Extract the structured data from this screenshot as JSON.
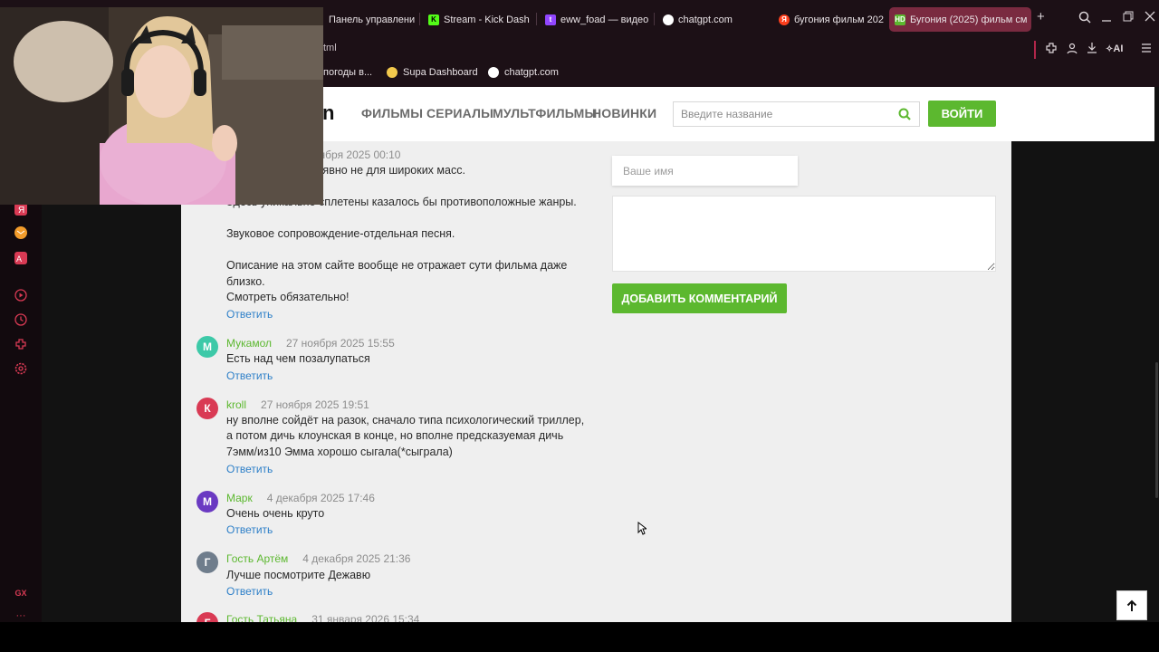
{
  "browser": {
    "tabs": [
      {
        "label": "Панель управлени",
        "color": "#7a6a70"
      },
      {
        "label": "Stream - Kick Dash",
        "color": "#53fc18"
      },
      {
        "label": "eww_foad — видео",
        "color": "#9146ff"
      },
      {
        "label": "chatgpt.com",
        "color": "#ffffff"
      },
      {
        "label": "бугония фильм 202",
        "color": "#fc3f1d"
      },
      {
        "label": "Бугония (2025) фильм см",
        "color": "#5cb82f",
        "fav_text": "HD"
      }
    ],
    "new_tab": "+",
    "url_fragment": "tml",
    "ai_label": "AI",
    "bookmarks": [
      {
        "label": "погоды в...",
        "color": "#4a8fd8"
      },
      {
        "label": "Supa Dashboard",
        "color": "#f2c94c"
      },
      {
        "label": "chatgpt.com",
        "color": "#ffffff"
      }
    ],
    "gx_label": "GX",
    "more_label": "···"
  },
  "site": {
    "logo_fragment": "n",
    "nav": [
      "ФИЛЬМЫ",
      "СЕРИАЛЫ",
      "МУЛЬТФИЛЬМЫ",
      "НОВИНКИ"
    ],
    "search_placeholder": "Введите название",
    "login_label": "ВОЙТИ",
    "accent": "#5cb82f"
  },
  "form": {
    "name_placeholder": "Ваше имя",
    "submit_label": "ДОБАВИТЬ КОММЕНТАРИЙ"
  },
  "first_comment": {
    "date_fragment": "оября 2025 00:10",
    "lines": [
      "о явно не для широких масс.",
      "Здесь уникально сплетены казалось бы противоположные жанры.",
      "Звуковое сопровождение-отдельная песня.",
      "Описание на этом сайте вообще не отражает сути фильма даже",
      "близко.",
      "Смотреть обязательно!"
    ],
    "reply": "Ответить"
  },
  "comments": [
    {
      "initial": "М",
      "avatar_color": "#3dc9a8",
      "author": "Мукамол",
      "date": "27 ноября 2025 15:55",
      "lines": [
        "Есть над чем позалупаться"
      ],
      "reply": "Ответить"
    },
    {
      "initial": "К",
      "avatar_color": "#d93a54",
      "author": "kroll",
      "date": "27 ноября 2025 19:51",
      "lines": [
        "ну вполне сойдёт на разок, сначало типа психологический триллер,",
        "а потом дичь клоунская в конце, но вполне предсказуемая дичь",
        "7эмм/из10 Эмма хорошо сыгала(*сыграла)"
      ],
      "reply": "Ответить"
    },
    {
      "initial": "М",
      "avatar_color": "#6a3ac2",
      "author": "Марк",
      "date": "4 декабря 2025 17:46",
      "lines": [
        "Очень очень круто"
      ],
      "reply": "Ответить"
    },
    {
      "initial": "Г",
      "avatar_color": "#6f7d8c",
      "author": "Гость Артём",
      "date": "4 декабря 2025 21:36",
      "lines": [
        "Лучше посмотрите Дежавю"
      ],
      "reply": "Ответить"
    },
    {
      "initial": "Г",
      "avatar_color": "#d93a54",
      "author": "Гость Татьяна",
      "date": "31 января 2026 15:34",
      "lines": [],
      "reply": ""
    }
  ]
}
